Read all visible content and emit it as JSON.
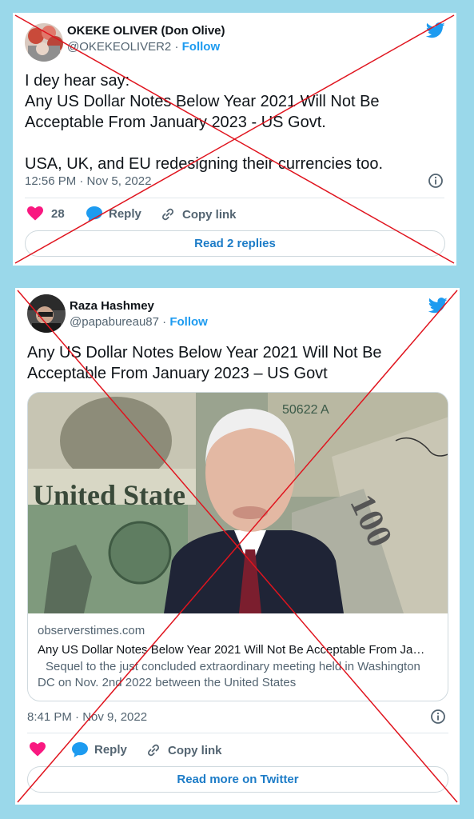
{
  "tweet1": {
    "display_name": "OKEKE OLIVER (Don Olive)",
    "handle": "@OKEKEOLIVER2",
    "separator": "·",
    "follow_label": "Follow",
    "text_lines": [
      "I dey hear say:",
      "Any US Dollar Notes Below Year 2021 Will Not Be",
      "Acceptable From January 2023 - US Govt.",
      "",
      "USA, UK, and EU redesigning their currencies too."
    ],
    "timestamp": "12:56 PM · Nov 5, 2022",
    "like_count": "28",
    "reply_label": "Reply",
    "copy_link_label": "Copy link",
    "read_replies_label": "Read 2 replies"
  },
  "tweet2": {
    "display_name": "Raza Hashmey",
    "handle": "@papabureau87",
    "separator": "·",
    "follow_label": "Follow",
    "text_lines": [
      "Any US Dollar Notes Below Year 2021 Will Not Be",
      "Acceptable From January 2023 – US Govt"
    ],
    "link_card": {
      "domain": "observerstimes.com",
      "title": "Any US Dollar Notes Below Year 2021 Will Not Be Acceptable From Ja…",
      "description": "Sequel to the just concluded extraordinary meeting held in Washington DC on Nov. 2nd 2022 between the United States",
      "image_texts": {
        "bill_text_1": "United State",
        "serial": "50622 A",
        "denomination": "100"
      }
    },
    "timestamp": "8:41 PM · Nov 9, 2022",
    "reply_label": "Reply",
    "copy_link_label": "Copy link",
    "read_more_label": "Read more on Twitter"
  },
  "icons": {
    "bird": "twitter-bird-icon",
    "heart": "heart-icon",
    "reply": "reply-bubble-icon",
    "link": "link-icon",
    "info": "info-icon"
  },
  "colors": {
    "background": "#9ad8ea",
    "accent": "#1d9bf0",
    "heart": "#f91880",
    "cross": "#e0141e"
  }
}
